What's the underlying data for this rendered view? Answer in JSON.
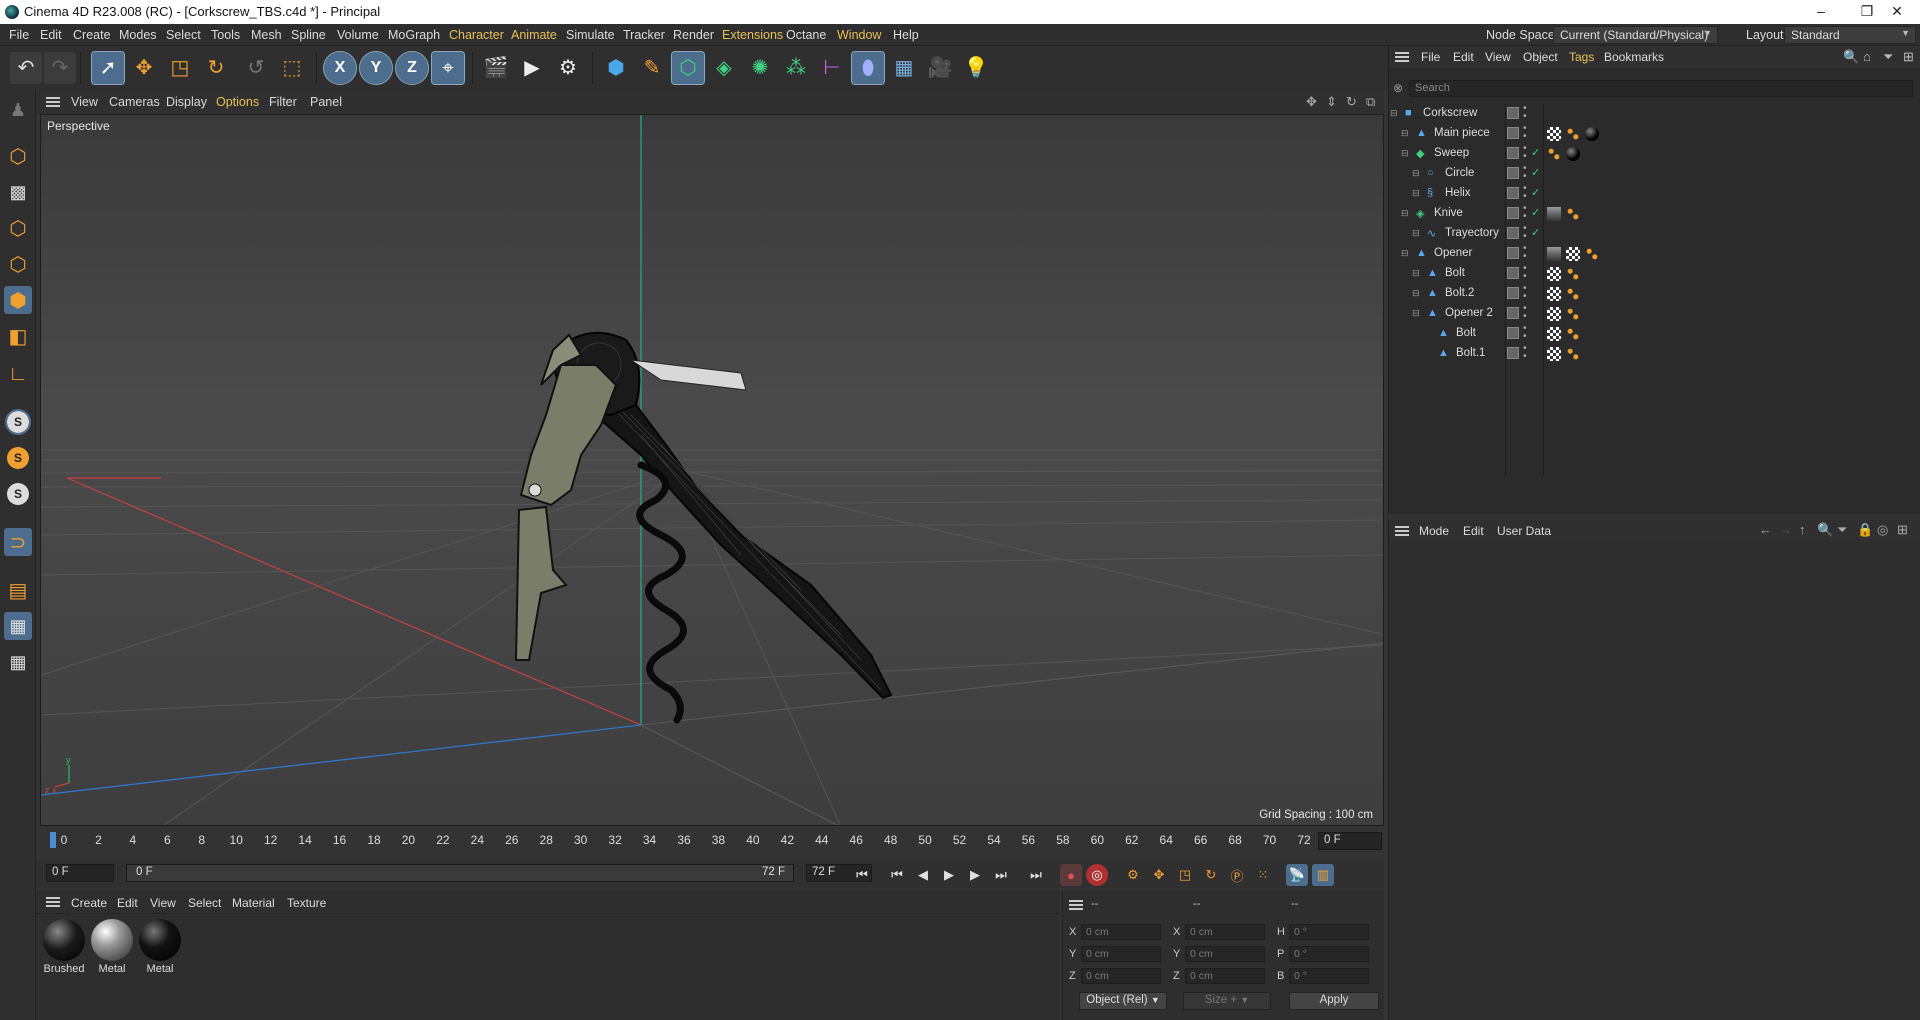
{
  "window": {
    "title": "Cinema 4D R23.008 (RC) - [Corkscrew_TBS.c4d *] - Principal",
    "controls": [
      "–",
      "❐",
      "✕"
    ]
  },
  "menubar": {
    "items": [
      "File",
      "Edit",
      "Create",
      "Modes",
      "Select",
      "Tools",
      "Mesh",
      "Spline",
      "Volume",
      "MoGraph",
      "Character",
      "Animate",
      "Simulate",
      "Tracker",
      "Render",
      "Extensions",
      "Octane",
      "Window",
      "Help"
    ],
    "node_space_label": "Node Space:",
    "node_space_value": "Current (Standard/Physical)",
    "layout_label": "Layout:",
    "layout_value": "Standard"
  },
  "toolbar": {
    "axis_x": "X",
    "axis_y": "Y",
    "axis_z": "Z"
  },
  "viewport": {
    "menu": [
      "View",
      "Cameras",
      "Display",
      "Options",
      "Filter",
      "Panel"
    ],
    "label": "Perspective",
    "grid_spacing": "Grid Spacing : 100 cm"
  },
  "timeline": {
    "ticks": [
      "0",
      "2",
      "4",
      "6",
      "8",
      "10",
      "12",
      "14",
      "16",
      "18",
      "20",
      "22",
      "24",
      "26",
      "28",
      "30",
      "32",
      "34",
      "36",
      "38",
      "40",
      "42",
      "44",
      "46",
      "48",
      "50",
      "52",
      "54",
      "56",
      "58",
      "60",
      "62",
      "64",
      "66",
      "68",
      "70",
      "72"
    ],
    "current_frame": "0 F",
    "start_frame": "0 F",
    "range_start": "0 F",
    "range_end": "72 F",
    "end_frame": "72 F"
  },
  "materials": {
    "menu": [
      "Create",
      "Edit",
      "View",
      "Select",
      "Material",
      "Texture"
    ],
    "items": [
      {
        "name": "Brushed",
        "color": "#1a1a1a"
      },
      {
        "name": "Metal",
        "color": "#9a9a9a"
      },
      {
        "name": "Metal",
        "color": "#121212"
      }
    ]
  },
  "coordinates": {
    "headers": [
      "--",
      "--",
      "--"
    ],
    "rows": [
      {
        "a": "X",
        "av": "0 cm",
        "b": "X",
        "bv": "0 cm",
        "c": "H",
        "cv": "0 °"
      },
      {
        "a": "Y",
        "av": "0 cm",
        "b": "Y",
        "bv": "0 cm",
        "c": "P",
        "cv": "0 °"
      },
      {
        "a": "Z",
        "av": "0 cm",
        "b": "Z",
        "bv": "0 cm",
        "c": "B",
        "cv": "0 °"
      }
    ],
    "mode_select": "Object (Rel)",
    "size_select": "Size +",
    "apply_label": "Apply"
  },
  "object_manager": {
    "menu": [
      "File",
      "Edit",
      "View",
      "Object",
      "Tags",
      "Bookmarks"
    ],
    "search_placeholder": "Search",
    "objects": [
      {
        "name": "Corkscrew",
        "depth": 0,
        "icon": "null-icon"
      },
      {
        "name": "Main piece",
        "depth": 1,
        "icon": "polygon-object-icon"
      },
      {
        "name": "Sweep",
        "depth": 1,
        "icon": "sweep-icon"
      },
      {
        "name": "Circle",
        "depth": 2,
        "icon": "circle-spline-icon"
      },
      {
        "name": "Helix",
        "depth": 2,
        "icon": "helix-spline-icon"
      },
      {
        "name": "Knive",
        "depth": 1,
        "icon": "extrude-icon"
      },
      {
        "name": "Trayectory",
        "depth": 2,
        "icon": "spline-icon"
      },
      {
        "name": "Opener",
        "depth": 1,
        "icon": "polygon-object-icon"
      },
      {
        "name": "Bolt",
        "depth": 2,
        "icon": "polygon-object-icon"
      },
      {
        "name": "Bolt.2",
        "depth": 2,
        "icon": "polygon-object-icon"
      },
      {
        "name": "Opener 2",
        "depth": 2,
        "icon": "polygon-object-icon"
      },
      {
        "name": "Bolt",
        "depth": 3,
        "icon": "polygon-object-icon"
      },
      {
        "name": "Bolt.1",
        "depth": 3,
        "icon": "polygon-object-icon"
      }
    ]
  },
  "attribute_manager": {
    "menu": [
      "Mode",
      "Edit",
      "User Data"
    ]
  },
  "colors": {
    "accent_yellow": "#e8c057",
    "selection_blue": "#4d6d8f",
    "axis_x": "#d04040",
    "axis_y": "#20c0a0",
    "axis_z": "#2a7bd0"
  }
}
